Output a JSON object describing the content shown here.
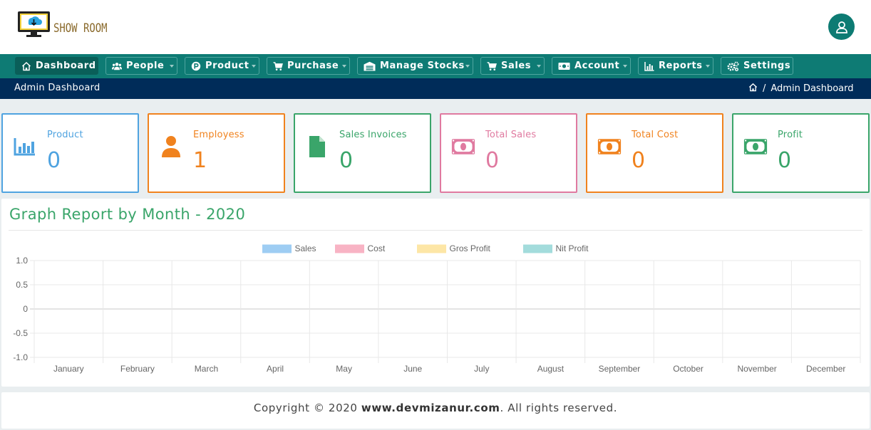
{
  "brand": {
    "logo_text": "SHOW ROOM"
  },
  "nav": {
    "items": [
      {
        "label": "Dashboard",
        "icon": "home-icon",
        "active": true
      },
      {
        "label": "People",
        "icon": "users-icon",
        "dropdown": true
      },
      {
        "label": "Product",
        "icon": "product-p-icon",
        "dropdown": true
      },
      {
        "label": "Purchase",
        "icon": "cart-icon",
        "dropdown": true
      },
      {
        "label": "Manage Stocks",
        "icon": "warehouse-icon",
        "dropdown": true
      },
      {
        "label": "Sales",
        "icon": "cart-icon",
        "dropdown": true
      },
      {
        "label": "Account",
        "icon": "money-icon",
        "dropdown": true
      },
      {
        "label": "Reports",
        "icon": "bar-chart-icon",
        "dropdown": true
      },
      {
        "label": "Settings",
        "icon": "gears-icon",
        "dropdown": false
      }
    ]
  },
  "breadcrumb": {
    "title": "Admin Dashboard",
    "current": "Admin Dashboard",
    "separator": "/"
  },
  "stats": [
    {
      "label": "Product",
      "value": "0",
      "color": "#4fa3e0",
      "icon": "bar-chart-icon"
    },
    {
      "label": "Employess",
      "value": "1",
      "color": "#f0821e",
      "icon": "user-icon"
    },
    {
      "label": "Sales Invoices",
      "value": "0",
      "color": "#3aa56a",
      "icon": "file-icon"
    },
    {
      "label": "Total Sales",
      "value": "0",
      "color": "#e07aa0",
      "icon": "money-icon"
    },
    {
      "label": "Total Cost",
      "value": "0",
      "color": "#f0821e",
      "icon": "money-icon"
    },
    {
      "label": "Profit",
      "value": "0",
      "color": "#3aa56a",
      "icon": "money-icon"
    }
  ],
  "graph": {
    "title": "Graph Report by Month - 2020"
  },
  "chart_data": {
    "type": "bar",
    "categories": [
      "January",
      "February",
      "March",
      "April",
      "May",
      "June",
      "July",
      "August",
      "September",
      "October",
      "November",
      "December"
    ],
    "series": [
      {
        "name": "Sales",
        "values": [
          0,
          0,
          0,
          0,
          0,
          0,
          0,
          0,
          0,
          0,
          0,
          0
        ],
        "color": "#9ecdf3"
      },
      {
        "name": "Cost",
        "values": [
          0,
          0,
          0,
          0,
          0,
          0,
          0,
          0,
          0,
          0,
          0,
          0
        ],
        "color": "#f8b3c4"
      },
      {
        "name": "Gros Profit",
        "values": [
          0,
          0,
          0,
          0,
          0,
          0,
          0,
          0,
          0,
          0,
          0,
          0
        ],
        "color": "#fde6a6"
      },
      {
        "name": "Nit Profit",
        "values": [
          0,
          0,
          0,
          0,
          0,
          0,
          0,
          0,
          0,
          0,
          0,
          0
        ],
        "color": "#a3dcdc"
      }
    ],
    "yticks": [
      "1.0",
      "0.5",
      "0",
      "-0.5",
      "-1.0"
    ],
    "ylim": [
      -1,
      1
    ],
    "grid": true,
    "legend": "top-center"
  },
  "footer": {
    "prefix": "Copyright © 2020 ",
    "site": "www.devmizanur.com",
    "suffix": ". All rights reserved."
  }
}
